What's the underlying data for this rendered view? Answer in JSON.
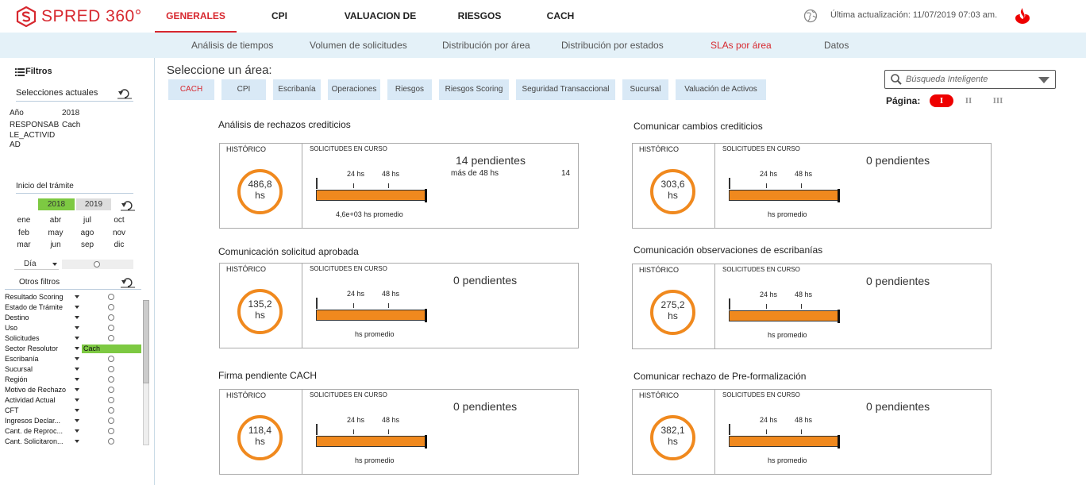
{
  "app": {
    "logo": "SPRED 360°"
  },
  "nav": {
    "tabs": [
      {
        "label": "GENERALES"
      },
      {
        "label": "CPI"
      },
      {
        "label": "VALUACION DE ACTIVOS"
      },
      {
        "label": "RIESGOS"
      },
      {
        "label": "CACH"
      }
    ],
    "active": "GENERALES",
    "last_update": "Última actualización: 11/07/2019 07:03 am."
  },
  "subnav": {
    "tabs": [
      {
        "label": "Análisis de tiempos"
      },
      {
        "label": "Volumen de solicitudes"
      },
      {
        "label": "Distribución por área"
      },
      {
        "label": "Distribución por estados"
      },
      {
        "label": "SLAs por área"
      },
      {
        "label": "Datos"
      }
    ],
    "active": "SLAs por área"
  },
  "sidebar": {
    "title": "Filtros",
    "current_selections_title": "Selecciones actuales",
    "selections": [
      {
        "key": "Año",
        "value": "2018"
      },
      {
        "key": "RESPONSAB",
        "value": "Cach"
      },
      {
        "key": "LE_ACTIVID",
        "value": ""
      },
      {
        "key": "AD",
        "value": ""
      }
    ],
    "inicio_title": "Inicio del trámite",
    "years": [
      "2018",
      "2019"
    ],
    "selected_year": "2018",
    "months": [
      [
        "ene",
        "abr",
        "jul",
        "oct"
      ],
      [
        "feb",
        "may",
        "ago",
        "nov"
      ],
      [
        "mar",
        "jun",
        "sep",
        "dic"
      ]
    ],
    "granularity": "Día",
    "otros_title": "Otros filtros",
    "filters": [
      {
        "label": "Resultado Scoring",
        "value": ""
      },
      {
        "label": "Estado de Trámite",
        "value": ""
      },
      {
        "label": "Destino",
        "value": ""
      },
      {
        "label": "Uso",
        "value": ""
      },
      {
        "label": "Solicitudes",
        "value": ""
      },
      {
        "label": "Sector Resolutor",
        "value": "Cach"
      },
      {
        "label": "Escribanía",
        "value": ""
      },
      {
        "label": "Sucursal",
        "value": ""
      },
      {
        "label": "Región",
        "value": ""
      },
      {
        "label": "Motivo de Rechazo",
        "value": ""
      },
      {
        "label": "Actividad Actual",
        "value": ""
      },
      {
        "label": "CFT",
        "value": ""
      },
      {
        "label": "Ingresos Declar...",
        "value": ""
      },
      {
        "label": "Cant. de Reproc...",
        "value": ""
      },
      {
        "label": "Cant. Solicitaron...",
        "value": ""
      }
    ]
  },
  "main": {
    "select_area_label": "Seleccione un área:",
    "areas": [
      "CACH",
      "CPI",
      "Escribanía",
      "Operaciones",
      "Riesgos",
      "Riesgos Scoring",
      "Seguridad Transaccional",
      "Sucursal",
      "Valuación de Activos"
    ],
    "active_area": "CACH",
    "search_placeholder": "Búsqueda Inteligente",
    "pagina_label": "Página:",
    "pages": [
      "I",
      "II",
      "III"
    ],
    "active_page": "I",
    "card_labels": {
      "historico": "HISTÓRICO",
      "solicitudes": "SOLICITUDES EN CURSO",
      "t24": "24 hs",
      "t48": "48 hs",
      "unit": "hs"
    },
    "cards": [
      {
        "title": "Análisis de rechazos crediticios",
        "historico": "486,8",
        "pendientes": "14 pendientes",
        "mas48": "más de 48 hs",
        "mas48_count": "14",
        "promedio": "4,6e+03 hs promedio"
      },
      {
        "title": "Comunicar cambios crediticios",
        "historico": "303,6",
        "pendientes": "0 pendientes",
        "mas48": "",
        "mas48_count": "",
        "promedio": "hs promedio"
      },
      {
        "title": "Comunicación solicitud aprobada",
        "historico": "135,2",
        "pendientes": "0 pendientes",
        "mas48": "",
        "mas48_count": "",
        "promedio": "hs promedio"
      },
      {
        "title": "Comunicación observaciones de escribanías",
        "historico": "275,2",
        "pendientes": "0 pendientes",
        "mas48": "",
        "mas48_count": "",
        "promedio": "hs promedio"
      },
      {
        "title": "Firma pendiente CACH",
        "historico": "118,4",
        "pendientes": "0 pendientes",
        "mas48": "",
        "mas48_count": "",
        "promedio": "hs promedio"
      },
      {
        "title": "Comunicar rechazo de Pre-formalización",
        "historico": "382,1",
        "pendientes": "0 pendientes",
        "mas48": "",
        "mas48_count": "",
        "promedio": "hs promedio"
      }
    ]
  },
  "colors": {
    "brand": "#d7282f",
    "accent": "#f0891e",
    "selected": "#7dc942",
    "subbar": "#e4f1f8"
  }
}
